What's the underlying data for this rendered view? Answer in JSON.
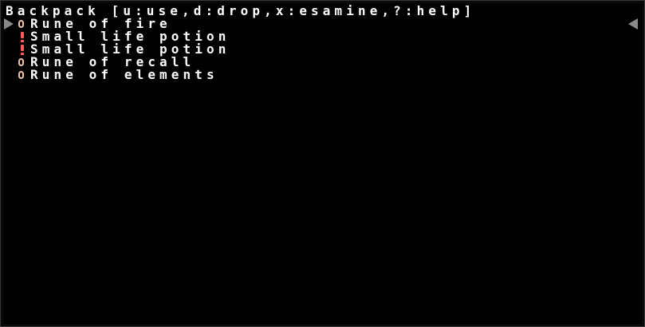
{
  "backpack": {
    "title": "Backpack [u:use,d:drop,x:esamine,?:help]",
    "items": [
      {
        "name": "Rune of fire",
        "icon": "rune-icon",
        "color": "#e8c8a8"
      },
      {
        "name": "Small life potion",
        "icon": "potion-icon",
        "color": "#ff5a5a"
      },
      {
        "name": "Small life potion",
        "icon": "potion-icon",
        "color": "#ff5a5a"
      },
      {
        "name": "Rune of recall",
        "icon": "rune-icon",
        "color": "#e8c8a8"
      },
      {
        "name": "Rune of elements",
        "icon": "rune-icon",
        "color": "#e8c8a8"
      }
    ]
  },
  "colors": {
    "background": "#000000",
    "text": "#ffffff",
    "frame": "#3a3a3a",
    "scroll_arrow": "#8a8a8a"
  },
  "icons": {
    "left_arrow": "triangle-right-icon",
    "right_arrow": "triangle-left-icon"
  }
}
